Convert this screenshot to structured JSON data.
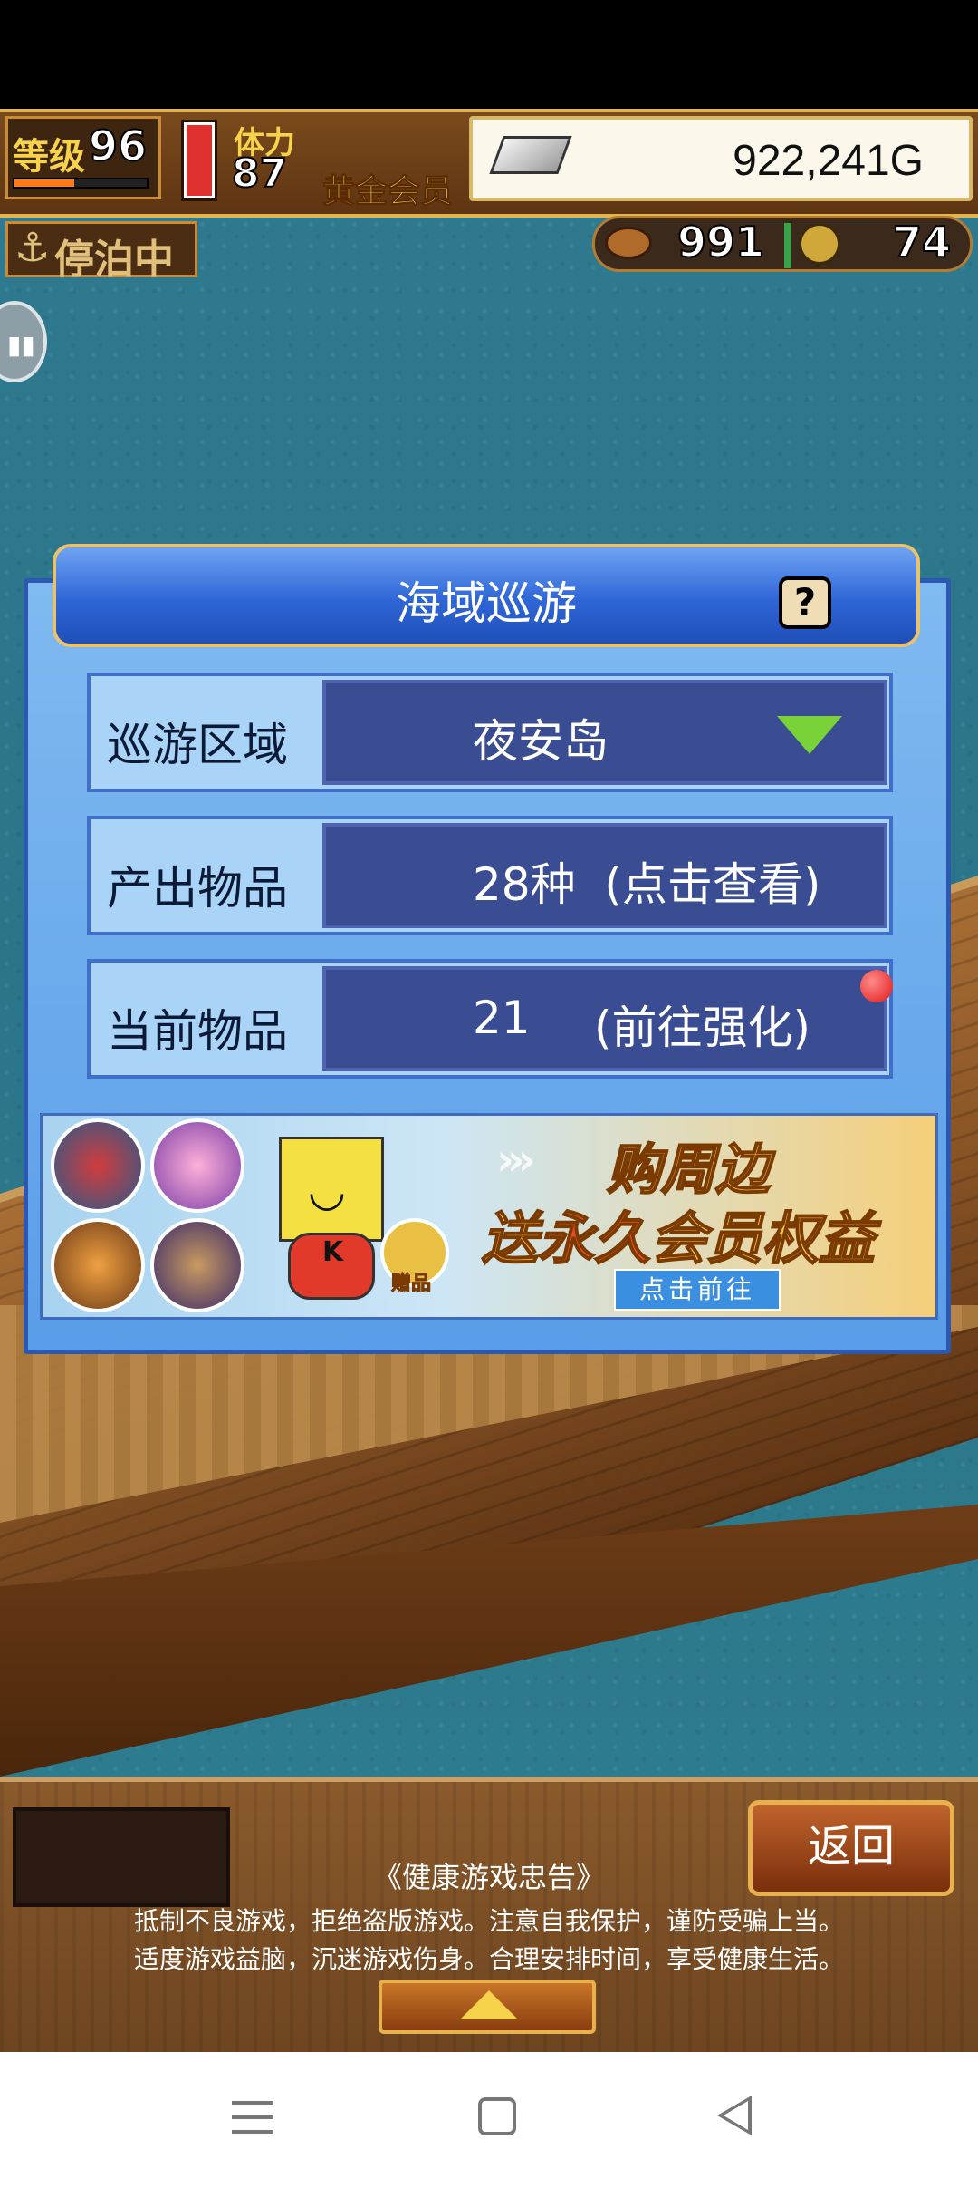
{
  "hud": {
    "level_label": "等级",
    "level_value": "96",
    "level_progress": 0.45,
    "stamina_label": "体力",
    "stamina_value": "87",
    "stamina_fill": 1.0,
    "membership": "黄金会员",
    "gold": "922,241G",
    "status_badge": "停泊中",
    "food_count": "991",
    "coin_count": "74"
  },
  "dialog": {
    "title": "海域巡游",
    "help_label": "?",
    "rows": [
      {
        "label": "巡游区域",
        "value": "夜安岛"
      },
      {
        "label": "产出物品",
        "value": "28种  (点击查看)"
      },
      {
        "label": "当前物品",
        "value_count": "21",
        "value_action": "(前往强化)"
      }
    ]
  },
  "banner": {
    "line1": "购周边",
    "line2_pre": "送",
    "line2_hl": "永久",
    "line2_post": "会员权益",
    "gift_label": "赠品",
    "chevrons": "›››",
    "cta": "点击前往",
    "mascot_letter": "K"
  },
  "bottom": {
    "back_label": "返回",
    "notice_title": "《健康游戏忠告》",
    "notice_line1": "抵制不良游戏，拒绝盗版游戏。注意自我保护，谨防受骗上当。",
    "notice_line2": "适度游戏益脑，沉迷游戏伤身。合理安排时间，享受健康生活。"
  },
  "icons": {
    "anchor": "⚓",
    "pause": "▮▮",
    "mascot_face": "◡"
  },
  "colors": {
    "dialog_bg": "#5a9de8",
    "row_value_bg": "#3a4c92",
    "dropdown_arrow": "#78d238",
    "notify_dot": "#e01818",
    "back_button": "#a04a1e"
  }
}
